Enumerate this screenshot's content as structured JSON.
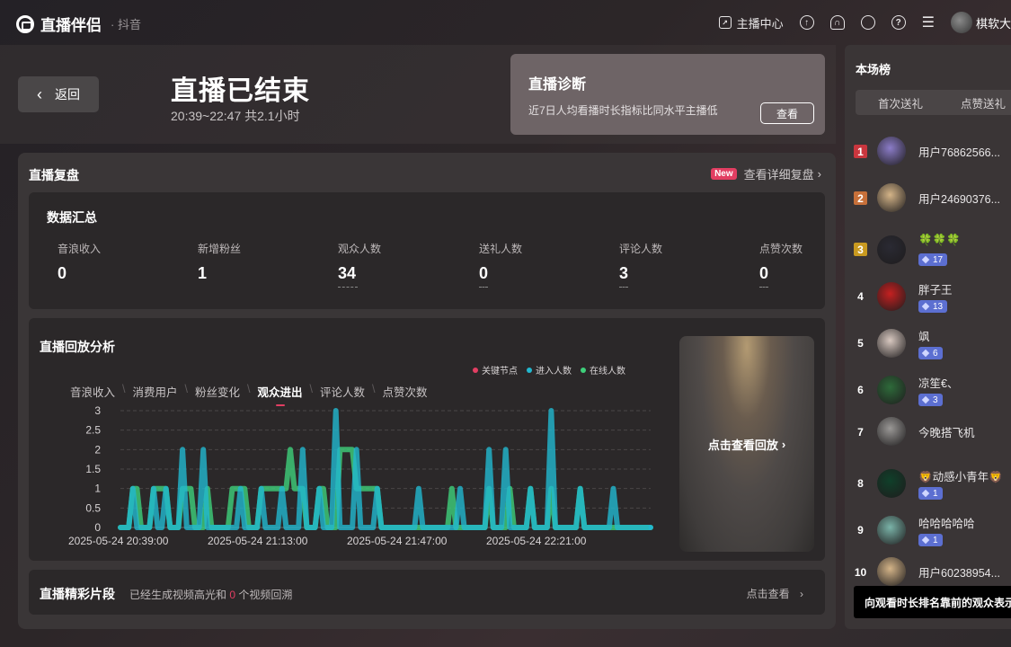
{
  "app": {
    "name": "直播伴侣",
    "platform": "· 抖音"
  },
  "topbar": {
    "broadcast_center": "主播中心",
    "user_name": "棋软大"
  },
  "header": {
    "back": "返回",
    "title": "直播已结束",
    "time_range": "20:39~22:47 共2.1小时"
  },
  "diagnosis": {
    "title": "直播诊断",
    "text": "近7日人均看播时长指标比同水平主播低",
    "button": "查看"
  },
  "review": {
    "title": "直播复盘",
    "new_badge": "New",
    "detail_link": "查看详细复盘",
    "summary": {
      "title": "数据汇总",
      "metrics": [
        {
          "label": "音浪收入",
          "value": "0"
        },
        {
          "label": "新增粉丝",
          "value": "1"
        },
        {
          "label": "观众人数",
          "value": "34"
        },
        {
          "label": "送礼人数",
          "value": "0"
        },
        {
          "label": "评论人数",
          "value": "3"
        },
        {
          "label": "点赞次数",
          "value": "0"
        }
      ]
    },
    "analysis": {
      "title": "直播回放分析",
      "legend": [
        {
          "label": "关键节点",
          "color": "#e23e62"
        },
        {
          "label": "进入人数",
          "color": "#22b8cf"
        },
        {
          "label": "在线人数",
          "color": "#3ecf7a"
        }
      ],
      "tabs": [
        "音浪收入",
        "消费用户",
        "粉丝变化",
        "观众进出",
        "评论人数",
        "点赞次数"
      ],
      "active_tab": "观众进出",
      "replay_label": "点击查看回放"
    },
    "clips": {
      "title": "直播精彩片段",
      "text_before": "已经生成视频高光和",
      "count": "0",
      "text_after": "个视频回溯",
      "link": "点击查看"
    }
  },
  "chart_data": {
    "type": "line",
    "x_ticks": [
      "2025-05-24 20:39:00",
      "2025-05-24 21:13:00",
      "2025-05-24 21:47:00",
      "2025-05-24 22:21:00"
    ],
    "y_ticks": [
      "3",
      "2.5",
      "2",
      "1.5",
      "1",
      "0.5",
      "0"
    ],
    "ylim": [
      0,
      3
    ],
    "xlim": [
      0,
      128
    ],
    "series": [
      {
        "name": "进入人数",
        "color": "#22b8cf",
        "points": [
          [
            0,
            0
          ],
          [
            2,
            0
          ],
          [
            3,
            1
          ],
          [
            4,
            0
          ],
          [
            7,
            0
          ],
          [
            8,
            1
          ],
          [
            9,
            0
          ],
          [
            10,
            0
          ],
          [
            11,
            1
          ],
          [
            12,
            0
          ],
          [
            14,
            0
          ],
          [
            15,
            2
          ],
          [
            16,
            0
          ],
          [
            19,
            0
          ],
          [
            20,
            2
          ],
          [
            21,
            0
          ],
          [
            28,
            0
          ],
          [
            29,
            1
          ],
          [
            30,
            0
          ],
          [
            33,
            0
          ],
          [
            34,
            1
          ],
          [
            35,
            0
          ],
          [
            38,
            0
          ],
          [
            39,
            1
          ],
          [
            40,
            0
          ],
          [
            43,
            0
          ],
          [
            44,
            2
          ],
          [
            45,
            0
          ],
          [
            47,
            0
          ],
          [
            48,
            1
          ],
          [
            49,
            0
          ],
          [
            51,
            0
          ],
          [
            52,
            3
          ],
          [
            53,
            0
          ],
          [
            56,
            0
          ],
          [
            57,
            2
          ],
          [
            58,
            0
          ],
          [
            61,
            0
          ],
          [
            62,
            1
          ],
          [
            63,
            0
          ],
          [
            71,
            0
          ],
          [
            72,
            1
          ],
          [
            73,
            0
          ],
          [
            81,
            0
          ],
          [
            82,
            1
          ],
          [
            83,
            0
          ],
          [
            88,
            0
          ],
          [
            89,
            2
          ],
          [
            90,
            0
          ],
          [
            92,
            0
          ],
          [
            93,
            2
          ],
          [
            94,
            0
          ],
          [
            98,
            0
          ],
          [
            99,
            1
          ],
          [
            100,
            0
          ],
          [
            103,
            0
          ],
          [
            104,
            3
          ],
          [
            105,
            0
          ],
          [
            110,
            0
          ],
          [
            111,
            1
          ],
          [
            112,
            0
          ],
          [
            118,
            0
          ],
          [
            119,
            1
          ],
          [
            120,
            0
          ],
          [
            127,
            0
          ],
          [
            128,
            0
          ]
        ]
      },
      {
        "name": "在线人数",
        "color": "#3ecf7a",
        "points": [
          [
            0,
            0
          ],
          [
            2,
            0
          ],
          [
            3,
            1
          ],
          [
            4,
            1
          ],
          [
            5,
            0
          ],
          [
            7,
            0
          ],
          [
            8,
            1
          ],
          [
            10,
            1
          ],
          [
            11,
            1
          ],
          [
            12,
            0
          ],
          [
            14,
            0
          ],
          [
            15,
            1
          ],
          [
            17,
            1
          ],
          [
            18,
            0
          ],
          [
            20,
            0
          ],
          [
            21,
            1
          ],
          [
            22,
            0
          ],
          [
            26,
            0
          ],
          [
            27,
            1
          ],
          [
            28,
            1
          ],
          [
            29,
            1
          ],
          [
            30,
            1
          ],
          [
            31,
            0
          ],
          [
            33,
            0
          ],
          [
            34,
            1
          ],
          [
            37,
            1
          ],
          [
            38,
            1
          ],
          [
            39,
            1
          ],
          [
            40,
            1
          ],
          [
            41,
            2
          ],
          [
            42,
            1
          ],
          [
            44,
            1
          ],
          [
            45,
            0
          ],
          [
            47,
            0
          ],
          [
            48,
            1
          ],
          [
            49,
            1
          ],
          [
            50,
            0
          ],
          [
            52,
            0
          ],
          [
            53,
            2
          ],
          [
            56,
            2
          ],
          [
            57,
            1
          ],
          [
            60,
            1
          ],
          [
            62,
            1
          ],
          [
            63,
            0
          ],
          [
            70,
            0
          ],
          [
            71,
            0
          ],
          [
            79,
            0
          ],
          [
            80,
            1
          ],
          [
            81,
            0
          ],
          [
            88,
            0
          ],
          [
            89,
            1
          ],
          [
            90,
            0
          ],
          [
            93,
            0
          ],
          [
            94,
            1
          ],
          [
            95,
            0
          ],
          [
            98,
            0
          ],
          [
            99,
            1
          ],
          [
            100,
            0
          ],
          [
            103,
            0
          ],
          [
            104,
            1
          ],
          [
            105,
            0
          ],
          [
            110,
            0
          ],
          [
            111,
            1
          ],
          [
            112,
            0
          ],
          [
            118,
            0
          ],
          [
            119,
            0
          ],
          [
            128,
            0
          ]
        ]
      }
    ]
  },
  "ranking": {
    "title": "本场榜",
    "tabs": [
      "首次送礼",
      "点赞送礼"
    ],
    "rows": [
      {
        "rank": "1",
        "name": "用户76862566...",
        "level": "",
        "rank_color": "#c9363e",
        "avatar": "#8b7cc8"
      },
      {
        "rank": "2",
        "name": "用户24690376...",
        "level": "",
        "rank_color": "#c7703a",
        "avatar": "#d4b488"
      },
      {
        "rank": "3",
        "name": "🍀🍀🍀",
        "level": "17",
        "rank_color": "#c99a20",
        "avatar": "#2a2a33"
      },
      {
        "rank": "4",
        "name": "胖子王",
        "level": "13",
        "rank_color": "",
        "avatar": "#c42020"
      },
      {
        "rank": "5",
        "name": "飒",
        "level": "6",
        "rank_color": "",
        "avatar": "#d8c8c0"
      },
      {
        "rank": "6",
        "name": "凉笙€、",
        "level": "3",
        "rank_color": "",
        "avatar": "#2e6a3a"
      },
      {
        "rank": "7",
        "name": "今晚搭飞机",
        "level": "",
        "rank_color": "",
        "avatar": "#9a9896"
      },
      {
        "rank": "8",
        "name": "🦁动感小青年🦁",
        "level": "1",
        "rank_color": "",
        "avatar": "#10402a"
      },
      {
        "rank": "9",
        "name": "哈哈哈哈哈",
        "level": "1",
        "rank_color": "",
        "avatar": "#7ab3a8"
      },
      {
        "rank": "10",
        "name": "用户60238954...",
        "level": "",
        "rank_color": "",
        "avatar": "#d4b488"
      }
    ]
  },
  "tooltip": "向观看时长排名靠前的观众表示"
}
